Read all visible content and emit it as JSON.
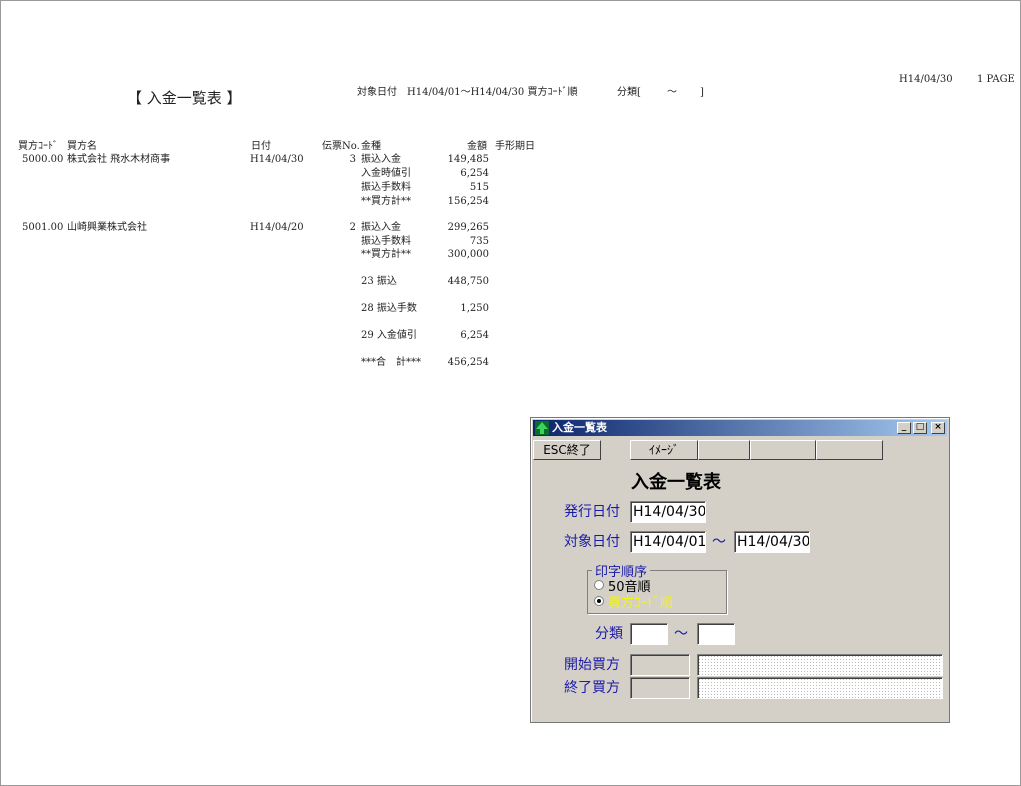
{
  "report": {
    "title": "【 入金一覧表 】",
    "criteria": "対象日付　H14/04/01～H14/04/30 買方ｺｰﾄﾞ順",
    "class_label": "分類[",
    "class_tilde": "～",
    "class_close": "]",
    "print_date": "H14/04/30",
    "page": "1 PAGE",
    "columns": {
      "buyer_code": "買方ｺｰﾄﾞ",
      "buyer_name": "買方名",
      "date": "日付",
      "slip_no": "伝票No.",
      "kind": "金種",
      "amount": "金額",
      "bill_due": "手形期日"
    },
    "groups": [
      {
        "buyer_code": "5000.00",
        "buyer_name": "株式会社 飛水木材商事",
        "date": "H14/04/30",
        "slip_no": "3",
        "lines": [
          {
            "kind": "振込入金",
            "amount": "149,485"
          },
          {
            "kind": "入金時値引",
            "amount": "6,254"
          },
          {
            "kind": "振込手数料",
            "amount": "515"
          },
          {
            "kind": "**買方計**",
            "amount": "156,254"
          }
        ]
      },
      {
        "buyer_code": "5001.00",
        "buyer_name": "山崎興業株式会社",
        "date": "H14/04/20",
        "slip_no": "2",
        "lines": [
          {
            "kind": "振込入金",
            "amount": "299,265"
          },
          {
            "kind": "振込手数料",
            "amount": "735"
          },
          {
            "kind": "**買方計**",
            "amount": "300,000"
          }
        ]
      }
    ],
    "summary": [
      {
        "kind": "23 振込",
        "amount": "448,750"
      },
      {
        "kind": "28 振込手数",
        "amount": "1,250"
      },
      {
        "kind": "29 入金値引",
        "amount": "6,254"
      },
      {
        "kind": "***合　計***",
        "amount": "456,254"
      }
    ]
  },
  "dialog": {
    "window_title": "入金一覧表",
    "esc_button": "ESC終了",
    "image_button": "ｲﾒｰｼﾞ",
    "heading": "入金一覧表",
    "issue_date_label": "発行日付",
    "issue_date": "H14/04/30",
    "target_date_label": "対象日付",
    "target_from": "H14/04/01",
    "target_tilde": "～",
    "target_to": "H14/04/30",
    "print_order_label": "印字順序",
    "order_option_1": "50音順",
    "order_option_2": "買方ｺｰﾄﾞ順",
    "class_label": "分類",
    "class_tilde": "～",
    "class_from": "",
    "class_to": "",
    "start_buyer_label": "開始買方",
    "end_buyer_label": "終了買方",
    "start_buyer_code": "",
    "start_buyer_name": "",
    "end_buyer_code": "",
    "end_buyer_name": ""
  }
}
